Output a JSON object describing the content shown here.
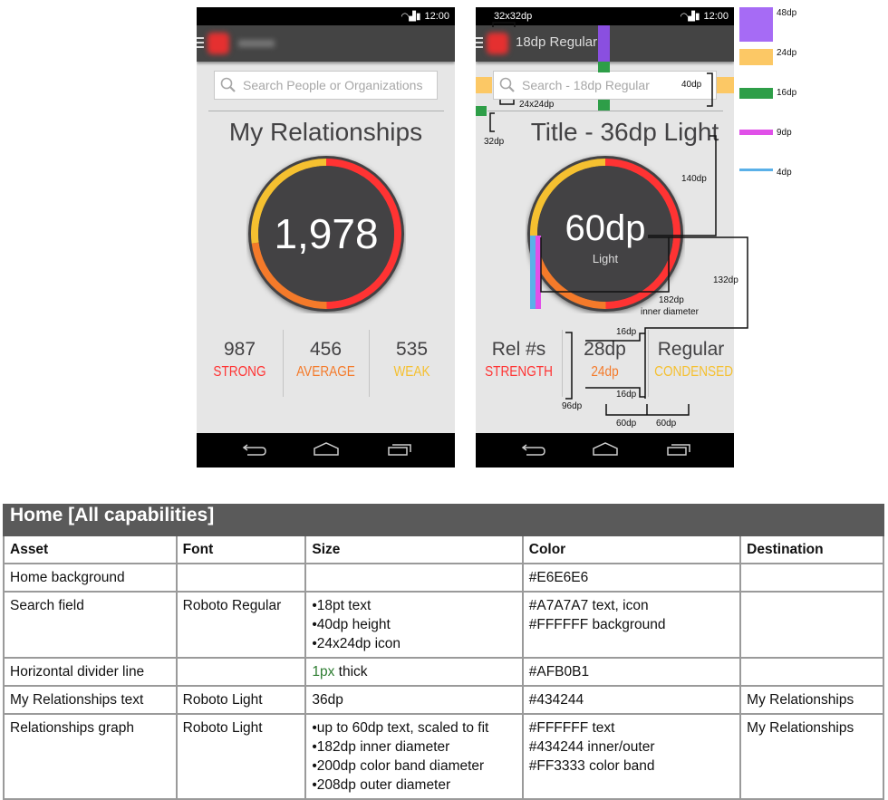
{
  "status_bar": {
    "time": "12:00",
    "icons": [
      "wifi-icon",
      "signal-icon",
      "battery-icon"
    ]
  },
  "phone_left": {
    "search_placeholder": "Search People or Organizations",
    "title": "My Relationships",
    "total": "1,978",
    "stats": [
      {
        "value": "987",
        "label": "STRONG",
        "color": "#FF3333"
      },
      {
        "value": "456",
        "label": "AVERAGE",
        "color": "#F47A2A"
      },
      {
        "value": "535",
        "label": "WEAK",
        "color": "#F5C030"
      }
    ]
  },
  "phone_right": {
    "app_name": "18dp Regular",
    "search_placeholder": "Search - 18dp Regular",
    "title": "Title - 36dp Light",
    "center_text": "60dp",
    "center_sub": "Light",
    "stats": [
      {
        "value": "Rel #s",
        "label": "STRENGTH",
        "color": "#FF3333"
      },
      {
        "value": "28dp",
        "label": "24dp",
        "color": "#F47A2A"
      },
      {
        "value": "Regular",
        "label": "CONDENSED",
        "color": "#F5C030"
      }
    ],
    "annotations": {
      "logo": "32x32dp",
      "search_height": "40dp",
      "icon": "24x24dp",
      "title_gap": "32dp",
      "title_to_ring": "140dp",
      "ring_to_stats": "132dp",
      "inner_diameter": "182dp",
      "inner_diameter_sub": "inner diameter",
      "gap_top": "16dp",
      "gap_bottom": "16dp",
      "stats_height": "96dp",
      "col1": "60dp",
      "col2": "60dp"
    }
  },
  "legend": [
    {
      "label": "48dp",
      "color": "#A66BF5"
    },
    {
      "label": "24dp",
      "color": "#FCC865"
    },
    {
      "label": "16dp",
      "color": "#2E9E48"
    },
    {
      "label": "9dp",
      "color": "#E050E8"
    },
    {
      "label": "4dp",
      "color": "#5AB0E8"
    }
  ],
  "ring_colors": {
    "strong": "#FF3333",
    "average": "#F47A2A",
    "weak": "#F5C030",
    "inner": "#434244"
  },
  "spec_table": {
    "title": "Home [All capabilities]",
    "headers": [
      "Asset",
      "Font",
      "Size",
      "Color",
      "Destination"
    ],
    "rows": [
      {
        "asset": "Home background",
        "font": "",
        "size": [],
        "color": [
          "#E6E6E6"
        ],
        "dest": ""
      },
      {
        "asset": "Search field",
        "font": "Roboto Regular",
        "size": [
          "•18pt text",
          "•40dp height",
          "•24x24dp icon"
        ],
        "color": [
          "#A7A7A7 text, icon",
          "#FFFFFF background"
        ],
        "dest": ""
      },
      {
        "asset": "Horizontal divider line",
        "font": "",
        "size_num": "1",
        "size_unit": "px",
        "size_rest": " thick",
        "color": [
          "#AFB0B1"
        ],
        "dest": ""
      },
      {
        "asset": "My Relationships text",
        "font": "Roboto Light",
        "size": [
          "36dp"
        ],
        "color": [
          "#434244"
        ],
        "dest": "My Relationships"
      },
      {
        "asset": "Relationships graph",
        "font": "Roboto Light",
        "size": [
          "•up to 60dp text, scaled to fit",
          "•182dp inner diameter",
          "•200dp color band diameter",
          "•208dp outer diameter"
        ],
        "color": [
          "#FFFFFF text",
          "#434244 inner/outer",
          "#FF3333 color band"
        ],
        "dest": "My Relationships"
      }
    ]
  }
}
